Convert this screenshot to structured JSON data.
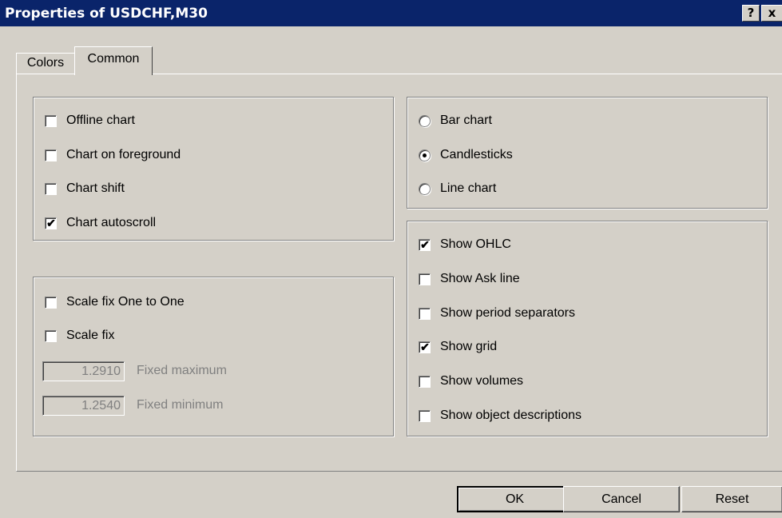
{
  "window": {
    "title": "Properties of USDCHF,M30",
    "help_label": "?",
    "close_label": "x"
  },
  "tabs": [
    {
      "label": "Colors",
      "active": false
    },
    {
      "label": "Common",
      "active": true
    }
  ],
  "general_options": [
    {
      "label": "Offline chart",
      "checked": false
    },
    {
      "label": "Chart on foreground",
      "checked": false
    },
    {
      "label": "Chart shift",
      "checked": false
    },
    {
      "label": "Chart autoscroll",
      "checked": true
    }
  ],
  "scale_options": {
    "checkboxes": [
      {
        "label": "Scale fix One to One",
        "checked": false
      },
      {
        "label": "Scale fix",
        "checked": false
      }
    ],
    "fixed_maximum": {
      "value": "1.2910",
      "label": "Fixed maximum",
      "enabled": false
    },
    "fixed_minimum": {
      "value": "1.2540",
      "label": "Fixed minimum",
      "enabled": false
    }
  },
  "chart_type": {
    "options": [
      {
        "label": "Bar chart",
        "selected": false
      },
      {
        "label": "Candlesticks",
        "selected": true
      },
      {
        "label": "Line chart",
        "selected": false
      }
    ]
  },
  "display_options": [
    {
      "label": "Show OHLC",
      "checked": true
    },
    {
      "label": "Show Ask line",
      "checked": false
    },
    {
      "label": "Show period separators",
      "checked": false
    },
    {
      "label": "Show grid",
      "checked": true
    },
    {
      "label": "Show volumes",
      "checked": false
    },
    {
      "label": "Show object descriptions",
      "checked": false
    }
  ],
  "buttons": {
    "ok": "OK",
    "cancel": "Cancel",
    "reset": "Reset"
  },
  "colors": {
    "titlebar": "#0a246a",
    "face": "#d4d0c8",
    "disabled_text": "#808080"
  }
}
